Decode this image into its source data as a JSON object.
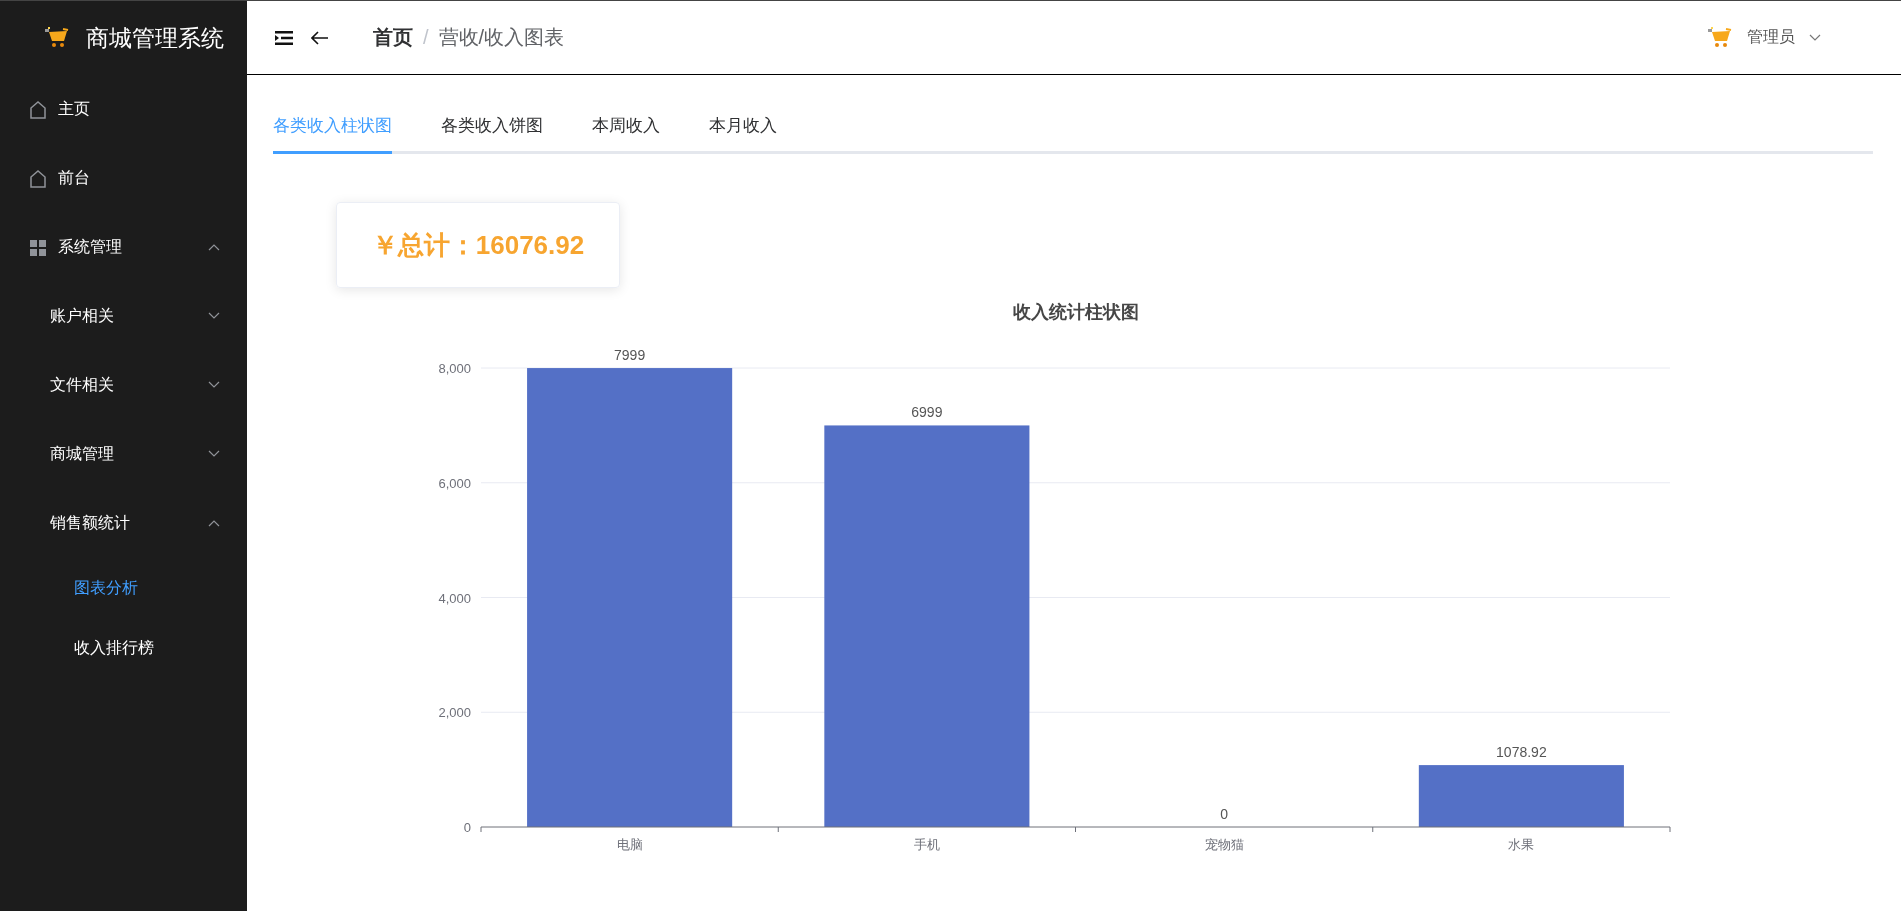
{
  "sidebar": {
    "app_title": "商城管理系统",
    "items": [
      {
        "label": "主页",
        "selected": false
      },
      {
        "label": "前台",
        "selected": false
      },
      {
        "label": "系统管理",
        "expanded": true,
        "children": [
          {
            "label": "账户相关",
            "expanded": false
          },
          {
            "label": "文件相关",
            "expanded": false
          },
          {
            "label": "商城管理",
            "expanded": false
          },
          {
            "label": "销售额统计",
            "expanded": true,
            "children": [
              {
                "label": "图表分析",
                "selected": true
              },
              {
                "label": "收入排行榜",
                "selected": false
              }
            ]
          }
        ]
      }
    ]
  },
  "header": {
    "breadcrumb": [
      "首页",
      "营收/收入图表"
    ],
    "separator": "/",
    "user": "管理员"
  },
  "tabs": [
    {
      "label": "各类收入柱状图",
      "selected": true
    },
    {
      "label": "各类收入饼图",
      "selected": false
    },
    {
      "label": "本周收入",
      "selected": false
    },
    {
      "label": "本月收入",
      "selected": false
    }
  ],
  "total": "￥总计：16076.92",
  "chart_data": {
    "type": "bar",
    "title": "收入统计柱状图",
    "categories": [
      "电脑",
      "手机",
      "宠物猫",
      "水果"
    ],
    "series": [
      {
        "color": "#5470c6",
        "values": [
          7999,
          6999,
          0,
          1078.92
        ]
      }
    ],
    "ylim": [
      0,
      8000
    ],
    "yticks": [
      {
        "value": 0,
        "label": "0"
      },
      {
        "value": 2000,
        "label": "2,000"
      },
      {
        "value": 4000,
        "label": "4,000"
      },
      {
        "value": 6000,
        "label": "6,000"
      },
      {
        "value": 8000,
        "label": "8,000"
      }
    ],
    "data_labels": true,
    "grid": true
  }
}
